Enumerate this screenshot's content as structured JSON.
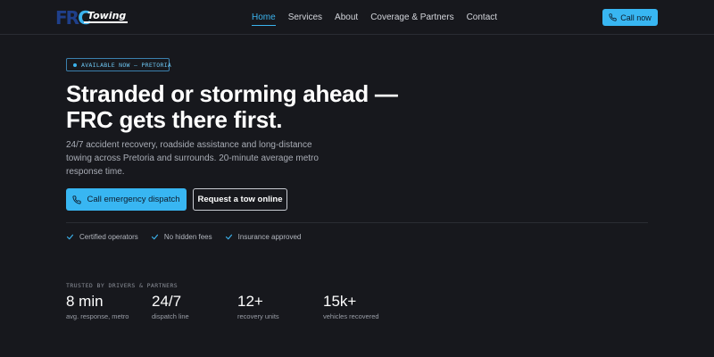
{
  "header": {
    "logo": {
      "letters_fr": "FR",
      "letter_c": "C",
      "sub": "Towing"
    },
    "nav": [
      {
        "label": "Home",
        "active": true
      },
      {
        "label": "Services",
        "active": false
      },
      {
        "label": "About",
        "active": false
      },
      {
        "label": "Coverage & Partners",
        "active": false
      },
      {
        "label": "Contact",
        "active": false
      }
    ],
    "call_now": "Call now",
    "call_icon": "phone-icon"
  },
  "hero": {
    "badge": "AVAILABLE NOW — PRETORIA",
    "headline_line1": "Stranded or storming ahead —",
    "headline_line2": "FRC gets there first.",
    "subtext": "24/7 accident recovery, roadside assistance and long-distance towing across Pretoria and surrounds. 20-minute average metro response time.",
    "primary_button": "Call emergency dispatch",
    "secondary_button": "Request a tow online",
    "checks": [
      "Certified operators",
      "No hidden fees",
      "Insurance approved"
    ]
  },
  "trusted": {
    "label": "TRUSTED BY DRIVERS & PARTNERS",
    "stats": [
      {
        "value": "8 min",
        "label": "avg. response, metro"
      },
      {
        "value": "24/7",
        "label": "dispatch line"
      },
      {
        "value": "12+",
        "label": "recovery units"
      },
      {
        "value": "15k+",
        "label": "vehicles recovered"
      }
    ]
  },
  "colors": {
    "background": "#17181d",
    "accent": "#38b6f2",
    "logo_blue": "#1f3f8a"
  }
}
